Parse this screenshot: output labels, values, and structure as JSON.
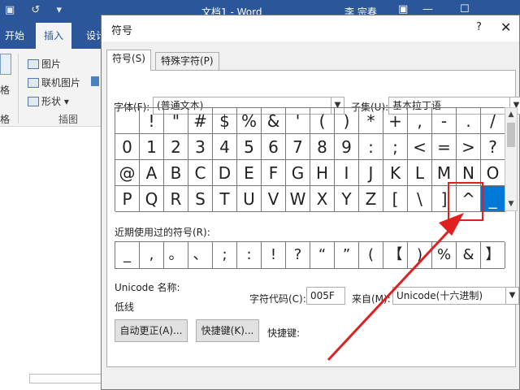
{
  "word": {
    "doc_title": "文档1 - Word",
    "user": "李 宗春",
    "ribbon_tabs": [
      "开始",
      "插入",
      "设计"
    ],
    "ribbon_items": [
      "图片",
      "联机图片",
      "形状"
    ],
    "group_label": "插图",
    "left_labels": [
      "格",
      "格"
    ]
  },
  "dialog": {
    "title": "符号",
    "help": "?",
    "close": "✕",
    "tabs": [
      "符号(S)",
      "特殊字符(P)"
    ],
    "font_label": "字体(F):",
    "font_value": "(普通文本)",
    "subset_label": "子集(U):",
    "subset_value": "基本拉丁语",
    "symbols": [
      [
        "",
        "!",
        "\"",
        "#",
        "$",
        "%",
        "&",
        "'",
        "(",
        ")",
        "*",
        "+",
        ",",
        "-",
        ".",
        "/"
      ],
      [
        "0",
        "1",
        "2",
        "3",
        "4",
        "5",
        "6",
        "7",
        "8",
        "9",
        ":",
        ";",
        "<",
        "=",
        ">",
        "?"
      ],
      [
        "@",
        "A",
        "B",
        "C",
        "D",
        "E",
        "F",
        "G",
        "H",
        "I",
        "J",
        "K",
        "L",
        "M",
        "N",
        "O"
      ],
      [
        "P",
        "Q",
        "R",
        "S",
        "T",
        "U",
        "V",
        "W",
        "X",
        "Y",
        "Z",
        "[",
        "\\",
        "]",
        "^",
        "_"
      ]
    ],
    "selected_symbol": "_",
    "recent_label": "近期使用过的符号(R):",
    "recent": [
      "_",
      ",",
      "。",
      "、",
      ";",
      ":",
      "!",
      "?",
      "“",
      "”",
      "(",
      "【",
      ")",
      "%",
      "&",
      "】"
    ],
    "unicode_name_label": "Unicode 名称:",
    "unicode_name": "低线",
    "char_code_label": "字符代码(C):",
    "char_code": "005F",
    "from_label": "来自(M):",
    "from_value": "Unicode(十六进制)",
    "autocorrect_button": "自动更正(A)...",
    "shortcut_button": "快捷键(K)...",
    "shortcut_label": "快捷键:"
  },
  "colors": {
    "word_blue": "#2b579a",
    "selection_blue": "#0078d7",
    "annotation_red": "#e02020"
  }
}
